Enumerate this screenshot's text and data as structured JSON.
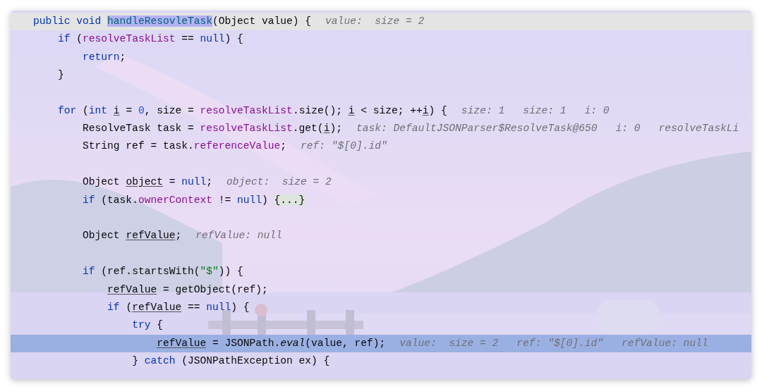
{
  "editor": {
    "lines": [
      {
        "kind": "caret",
        "tokens": [
          {
            "text": "public void ",
            "kind": "keyword"
          },
          {
            "text": "handleResovleTask",
            "kind": "selected"
          },
          {
            "text": "(Object value) {",
            "kind": "plain"
          }
        ],
        "hints": [
          "value:  size = 2"
        ]
      },
      {
        "kind": "normal",
        "tokens": [
          {
            "text": "    if ",
            "kind": "keyword"
          },
          {
            "text": "(",
            "kind": "plain"
          },
          {
            "text": "resolveTaskList",
            "kind": "field"
          },
          {
            "text": " == ",
            "kind": "plain"
          },
          {
            "text": "null",
            "kind": "keyword"
          },
          {
            "text": ") {",
            "kind": "plain"
          }
        ]
      },
      {
        "kind": "normal",
        "tokens": [
          {
            "text": "        return",
            "kind": "keyword"
          },
          {
            "text": ";",
            "kind": "plain"
          }
        ]
      },
      {
        "kind": "normal",
        "tokens": [
          {
            "text": "    }",
            "kind": "plain"
          }
        ]
      },
      {
        "kind": "normal"
      },
      {
        "kind": "normal",
        "tokens": [
          {
            "text": "    for ",
            "kind": "keyword"
          },
          {
            "text": "(",
            "kind": "plain"
          },
          {
            "text": "int ",
            "kind": "keyword"
          },
          {
            "text": "i",
            "kind": "underlined"
          },
          {
            "text": " = ",
            "kind": "plain"
          },
          {
            "text": "0",
            "kind": "number"
          },
          {
            "text": ", size = ",
            "kind": "plain"
          },
          {
            "text": "resolveTaskList",
            "kind": "field"
          },
          {
            "text": ".size(); ",
            "kind": "plain"
          },
          {
            "text": "i",
            "kind": "underlined"
          },
          {
            "text": " < size; ++",
            "kind": "plain"
          },
          {
            "text": "i",
            "kind": "underlined"
          },
          {
            "text": ") {",
            "kind": "plain"
          }
        ],
        "hints": [
          "size: 1",
          "size: 1",
          "i: 0"
        ]
      },
      {
        "kind": "normal",
        "tokens": [
          {
            "text": "        ResolveTask task = ",
            "kind": "plain"
          },
          {
            "text": "resolveTaskList",
            "kind": "field"
          },
          {
            "text": ".get(",
            "kind": "plain"
          },
          {
            "text": "i",
            "kind": "underlined"
          },
          {
            "text": ");",
            "kind": "plain"
          }
        ],
        "hints": [
          "task: DefaultJSONParser$ResolveTask@650",
          "i: 0",
          "resolveTaskLi"
        ]
      },
      {
        "kind": "normal",
        "tokens": [
          {
            "text": "        String ref = task.",
            "kind": "plain"
          },
          {
            "text": "referenceValue",
            "kind": "field"
          },
          {
            "text": ";",
            "kind": "plain"
          }
        ],
        "hints": [
          "ref: \"$[0].id\""
        ]
      },
      {
        "kind": "normal"
      },
      {
        "kind": "normal",
        "tokens": [
          {
            "text": "        Object ",
            "kind": "plain"
          },
          {
            "text": "object",
            "kind": "underlined"
          },
          {
            "text": " = ",
            "kind": "plain"
          },
          {
            "text": "null",
            "kind": "keyword"
          },
          {
            "text": ";",
            "kind": "plain"
          }
        ],
        "hints": [
          "object:  size = 2"
        ]
      },
      {
        "kind": "normal",
        "tokens": [
          {
            "text": "        if ",
            "kind": "keyword"
          },
          {
            "text": "(task.",
            "kind": "plain"
          },
          {
            "text": "ownerContext",
            "kind": "field"
          },
          {
            "text": " != ",
            "kind": "plain"
          },
          {
            "text": "null",
            "kind": "keyword"
          },
          {
            "text": ") ",
            "kind": "plain"
          },
          {
            "text": "{...}",
            "kind": "folded"
          }
        ]
      },
      {
        "kind": "normal"
      },
      {
        "kind": "normal",
        "tokens": [
          {
            "text": "        Object ",
            "kind": "plain"
          },
          {
            "text": "refValue",
            "kind": "underlined"
          },
          {
            "text": ";",
            "kind": "plain"
          }
        ],
        "hints": [
          "refValue: null"
        ]
      },
      {
        "kind": "normal"
      },
      {
        "kind": "normal",
        "tokens": [
          {
            "text": "        if ",
            "kind": "keyword"
          },
          {
            "text": "(ref.startsWith(",
            "kind": "plain"
          },
          {
            "text": "\"$\"",
            "kind": "string"
          },
          {
            "text": ")) {",
            "kind": "plain"
          }
        ]
      },
      {
        "kind": "normal",
        "tokens": [
          {
            "text": "            refValue",
            "kind": "underlined"
          },
          {
            "text": " = getObject(ref);",
            "kind": "plain"
          }
        ]
      },
      {
        "kind": "normal",
        "tokens": [
          {
            "text": "            if ",
            "kind": "keyword"
          },
          {
            "text": "(",
            "kind": "plain"
          },
          {
            "text": "refValue",
            "kind": "underlined"
          },
          {
            "text": " == ",
            "kind": "plain"
          },
          {
            "text": "null",
            "kind": "keyword"
          },
          {
            "text": ") {",
            "kind": "plain"
          }
        ]
      },
      {
        "kind": "normal",
        "tokens": [
          {
            "text": "                try ",
            "kind": "keyword"
          },
          {
            "text": "{",
            "kind": "plain"
          }
        ]
      },
      {
        "kind": "execution",
        "tokens": [
          {
            "text": "                    refValue",
            "kind": "underlined"
          },
          {
            "text": " = JSONPath.",
            "kind": "plain"
          },
          {
            "text": "eval",
            "kind": "italic"
          },
          {
            "text": "(value, ref);",
            "kind": "plain"
          }
        ],
        "hints": [
          "value:  size = 2",
          "ref: \"$[0].id\"",
          "refValue: null"
        ]
      },
      {
        "kind": "normal",
        "tokens": [
          {
            "text": "                } ",
            "kind": "plain"
          },
          {
            "text": "catch ",
            "kind": "keyword"
          },
          {
            "text": "(JSONPathException ex) {",
            "kind": "plain"
          }
        ]
      }
    ]
  }
}
